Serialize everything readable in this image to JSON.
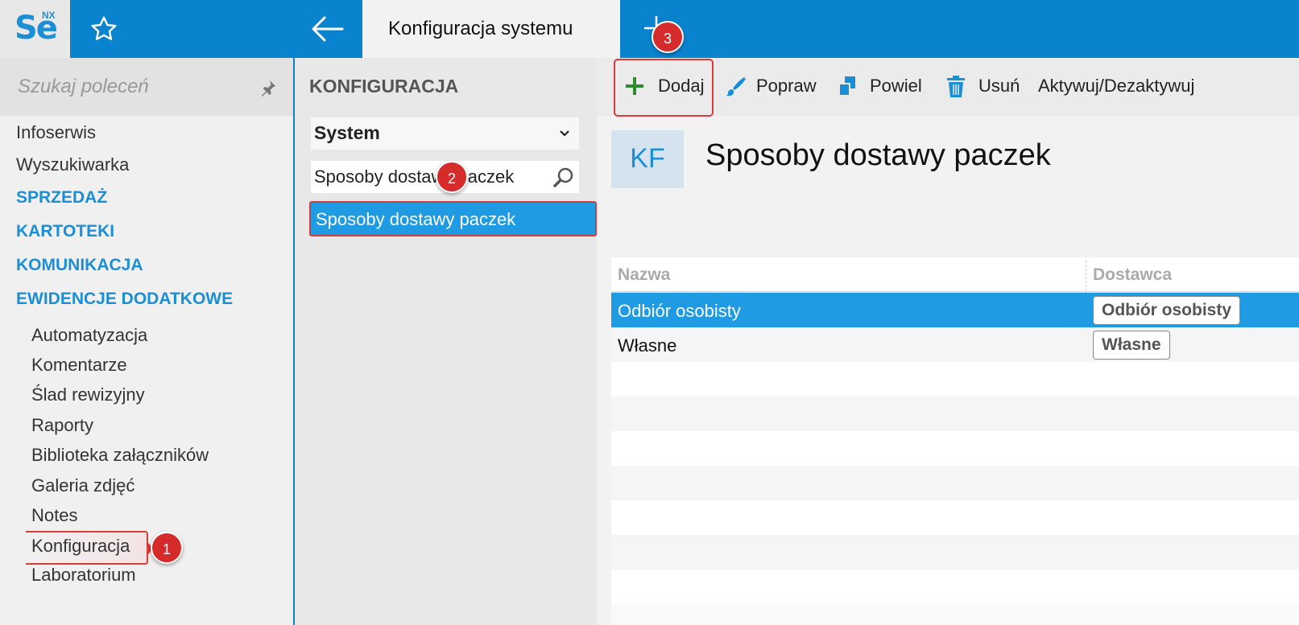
{
  "app": {
    "logo_text": "Se",
    "logo_sup": "NX"
  },
  "tabs": {
    "active_label": "Konfiguracja systemu"
  },
  "nav": {
    "search_placeholder": "Szukaj poleceń",
    "top_items": [
      "Infoserwis",
      "Wyszukiwarka"
    ],
    "sections": [
      "SPRZEDAŻ",
      "KARTOTEKI",
      "KOMUNIKACJA",
      "EWIDENCJE DODATKOWE"
    ],
    "sub_items": [
      "Automatyzacja",
      "Komentarze",
      "Ślad rewizyjny",
      "Raporty",
      "Biblioteka załączników",
      "Galeria zdjęć",
      "Notes",
      "Konfiguracja",
      "Laboratorium"
    ]
  },
  "middle": {
    "heading": "KONFIGURACJA",
    "select_value": "System",
    "filter_value": "Sposoby dostawy paczek",
    "result_label": "Sposoby dostawy paczek"
  },
  "toolbar": {
    "add_label": "Dodaj",
    "edit_label": "Popraw",
    "duplicate_label": "Powiel",
    "delete_label": "Usuń",
    "toggle_label": "Aktywuj/Dezaktywuj"
  },
  "content": {
    "badge_initials": "KF",
    "title": "Sposoby dostawy paczek"
  },
  "grid": {
    "columns": [
      "Nazwa",
      "Dostawca"
    ],
    "rows": [
      {
        "name": "Odbiór osobisty",
        "supplier": "Odbiór osobisty"
      },
      {
        "name": "Własne",
        "supplier": "Własne"
      }
    ]
  },
  "annotations": [
    "1",
    "2",
    "3"
  ],
  "colors": {
    "brand_blue": "#0a83cf",
    "selection_blue": "#1e9be2",
    "highlight_red": "#d93b3b",
    "add_green": "#2e8b2e"
  }
}
